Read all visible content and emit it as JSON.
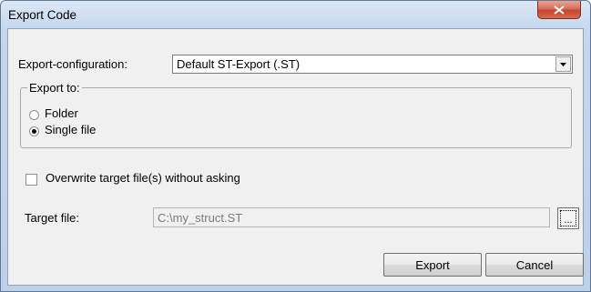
{
  "window": {
    "title": "Export Code",
    "close_icon": "close-icon"
  },
  "export_config": {
    "label": "Export-configuration:",
    "selected": "Default ST-Export (.ST)"
  },
  "export_to": {
    "legend": "Export to:",
    "options": [
      {
        "label": "Folder",
        "selected": false
      },
      {
        "label": "Single file",
        "selected": true
      }
    ]
  },
  "overwrite": {
    "label": "Overwrite target file(s) without asking",
    "checked": false
  },
  "target_file": {
    "label": "Target file:",
    "value": "C:\\my_struct.ST",
    "browse_label": "..."
  },
  "buttons": {
    "export": "Export",
    "cancel": "Cancel"
  }
}
